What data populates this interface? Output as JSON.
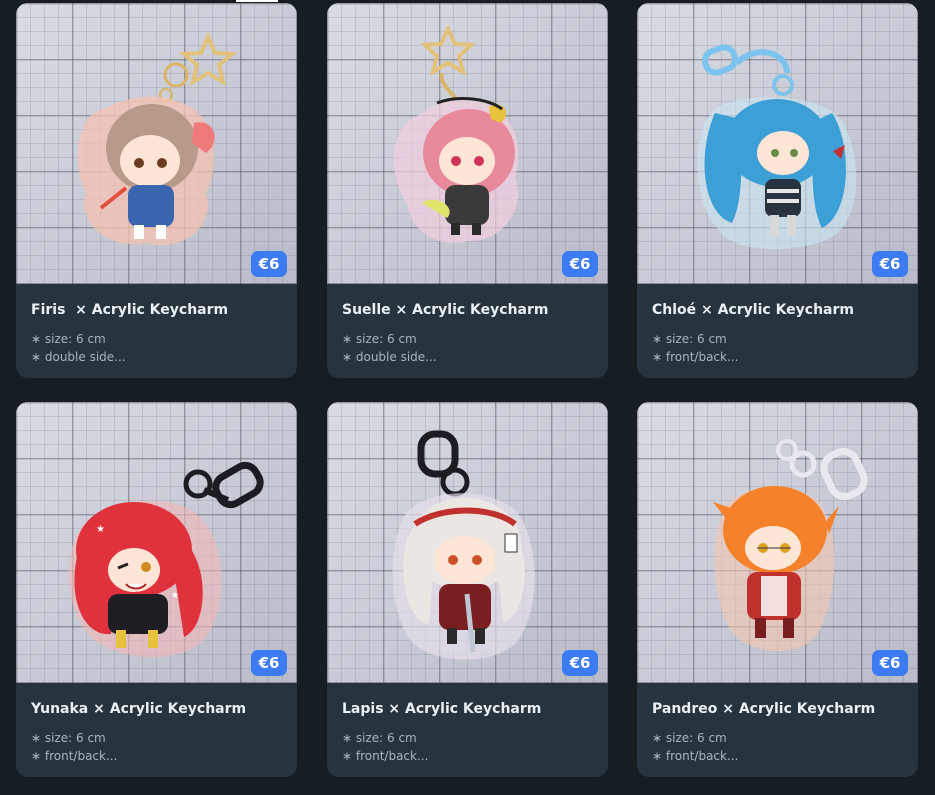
{
  "currency": "€",
  "products": [
    {
      "name": "Firis",
      "title": "Firis  × Acrylic Keycharm",
      "price": "€6",
      "detail1": "∗ size: 6 cm",
      "detail2": "∗ double side...",
      "hair_color": "#b89a8a",
      "accent_color": "#f07a7a",
      "hook_color": "#e2c27a",
      "hook": "star-ring-icon"
    },
    {
      "name": "Suelle",
      "title": "Suelle × Acrylic Keycharm",
      "price": "€6",
      "detail1": "∗ size: 6 cm",
      "detail2": "∗ double side...",
      "hair_color": "#e98a9c",
      "accent_color": "#e8c23a",
      "hook_color": "#e2c27a",
      "hook": "star-ring-icon"
    },
    {
      "name": "Chloé",
      "title": "Chloé × Acrylic Keycharm",
      "price": "€6",
      "detail1": "∗ size: 6 cm",
      "detail2": "∗ front/back...",
      "hair_color": "#3c9fd6",
      "accent_color": "#2a3340",
      "hook_color": "#7cc4ee",
      "hook": "swivel-clasp-icon"
    },
    {
      "name": "Yunaka",
      "title": "Yunaka × Acrylic Keycharm",
      "price": "€6",
      "detail1": "∗ size: 6 cm",
      "detail2": "∗ front/back...",
      "hair_color": "#e0323c",
      "accent_color": "#1e1e24",
      "hook_color": "#1c1c22",
      "hook": "swivel-clasp-icon"
    },
    {
      "name": "Lapis",
      "title": "Lapis × Acrylic Keycharm",
      "price": "€6",
      "detail1": "∗ size: 6 cm",
      "detail2": "∗ front/back...",
      "hair_color": "#ece6e2",
      "accent_color": "#c0302c",
      "hook_color": "#1c1c22",
      "hook": "swivel-clasp-icon"
    },
    {
      "name": "Pandreo",
      "title": "Pandreo × Acrylic Keycharm",
      "price": "€6",
      "detail1": "∗ size: 6 cm",
      "detail2": "∗ front/back...",
      "hair_color": "#f5822a",
      "accent_color": "#c0302c",
      "hook_color": "#e8e8ee",
      "hook": "swivel-clasp-icon"
    }
  ]
}
